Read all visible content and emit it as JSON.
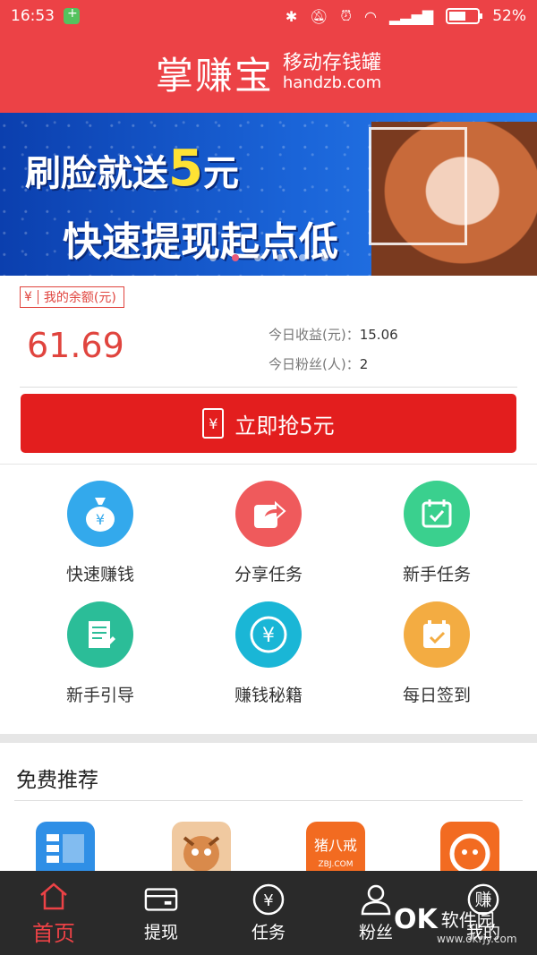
{
  "status": {
    "time": "16:53",
    "battery": "52%",
    "net": "3G"
  },
  "header": {
    "brand": "掌赚宝",
    "sub_cn": "移动存钱罐",
    "sub_en": "handzb.com"
  },
  "banner": {
    "line1_pre": "刷脸就送",
    "line1_num": "5",
    "line1_post": "元",
    "line2": "快速提现起点低",
    "slides": 6,
    "active_slide": 2
  },
  "balance": {
    "tag_yen": "¥",
    "tag_label": "我的余额(元)",
    "amount": "61.69",
    "today_income_label": "今日收益(元)：",
    "today_income_value": "15.06",
    "today_fans_label": "今日粉丝(人)：",
    "today_fans_value": "2",
    "grab_icon": "¥",
    "grab_label": "立即抢5元"
  },
  "menu": [
    {
      "label": "快速赚钱",
      "icon": "money-bag-icon",
      "color": "#33a9ec"
    },
    {
      "label": "分享任务",
      "icon": "share-icon",
      "color": "#ef5a5c"
    },
    {
      "label": "新手任务",
      "icon": "calendar-check-icon",
      "color": "#3ad08e"
    },
    {
      "label": "新手引导",
      "icon": "guide-document-icon",
      "color": "#2bbd98"
    },
    {
      "label": "赚钱秘籍",
      "icon": "yen-coin-icon",
      "color": "#1ab6d6"
    },
    {
      "label": "每日签到",
      "icon": "daily-signin-icon",
      "color": "#f3ac42"
    }
  ],
  "recommend": {
    "title": "免费推荐"
  },
  "tabs": [
    {
      "label": "首页",
      "icon": "home-icon"
    },
    {
      "label": "提现",
      "icon": "card-icon"
    },
    {
      "label": "任务",
      "icon": "yen-circle-icon"
    },
    {
      "label": "粉丝",
      "icon": "user-icon"
    },
    {
      "label": "我的",
      "icon": "earn-icon",
      "icon_text": "赚"
    }
  ],
  "watermark": {
    "ok": "OK",
    "cn": "软件园",
    "url": "www.okrjy.com"
  }
}
